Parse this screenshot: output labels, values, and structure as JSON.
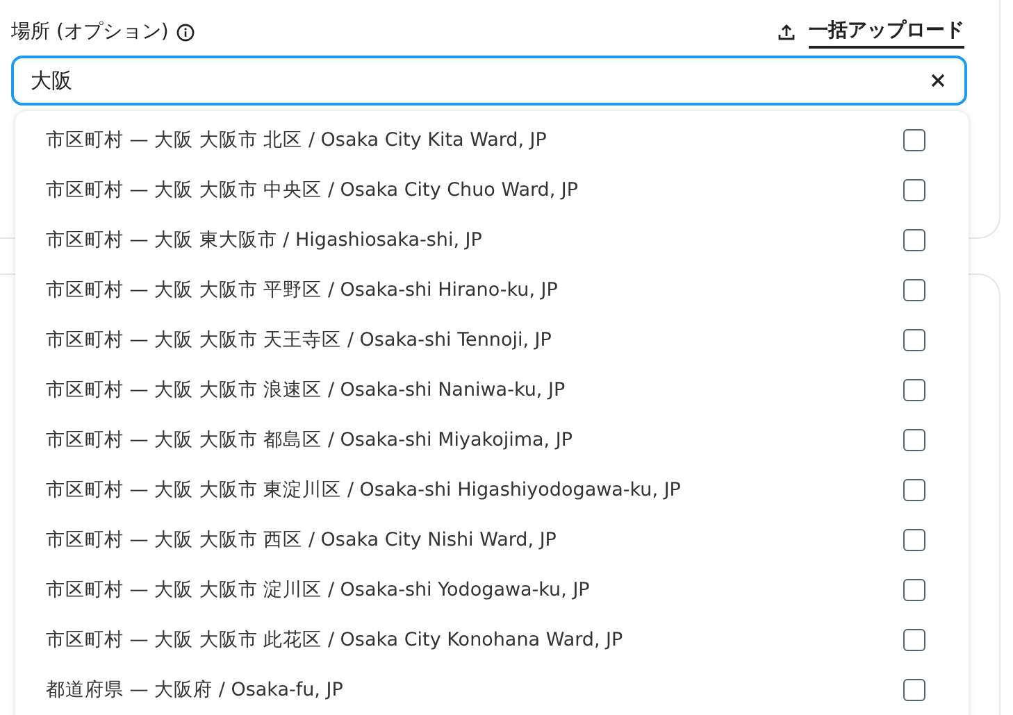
{
  "field": {
    "label": "場所 (オプション)",
    "value": "大阪",
    "bulk_upload": "一括アップロード"
  },
  "options": [
    {
      "label": "市区町村 — 大阪 大阪市 北区 / Osaka City Kita Ward, JP",
      "checked": false
    },
    {
      "label": "市区町村 — 大阪 大阪市 中央区 / Osaka City Chuo Ward, JP",
      "checked": false
    },
    {
      "label": "市区町村 — 大阪 東大阪市 / Higashiosaka-shi, JP",
      "checked": false
    },
    {
      "label": "市区町村 — 大阪 大阪市 平野区 / Osaka-shi Hirano-ku, JP",
      "checked": false
    },
    {
      "label": "市区町村 — 大阪 大阪市 天王寺区 / Osaka-shi Tennoji, JP",
      "checked": false
    },
    {
      "label": "市区町村 — 大阪 大阪市 浪速区 / Osaka-shi Naniwa-ku, JP",
      "checked": false
    },
    {
      "label": "市区町村 — 大阪 大阪市 都島区 / Osaka-shi Miyakojima, JP",
      "checked": false
    },
    {
      "label": "市区町村 — 大阪 大阪市 東淀川区 / Osaka-shi Higashiyodogawa-ku, JP",
      "checked": false
    },
    {
      "label": "市区町村 — 大阪 大阪市 西区 / Osaka City Nishi Ward, JP",
      "checked": false
    },
    {
      "label": "市区町村 — 大阪 大阪市 淀川区 / Osaka-shi Yodogawa-ku, JP",
      "checked": false
    },
    {
      "label": "市区町村 — 大阪 大阪市 此花区 / Osaka City Konohana Ward, JP",
      "checked": false
    },
    {
      "label": "都道府県 — 大阪府 / Osaka-fu, JP",
      "checked": false
    }
  ]
}
